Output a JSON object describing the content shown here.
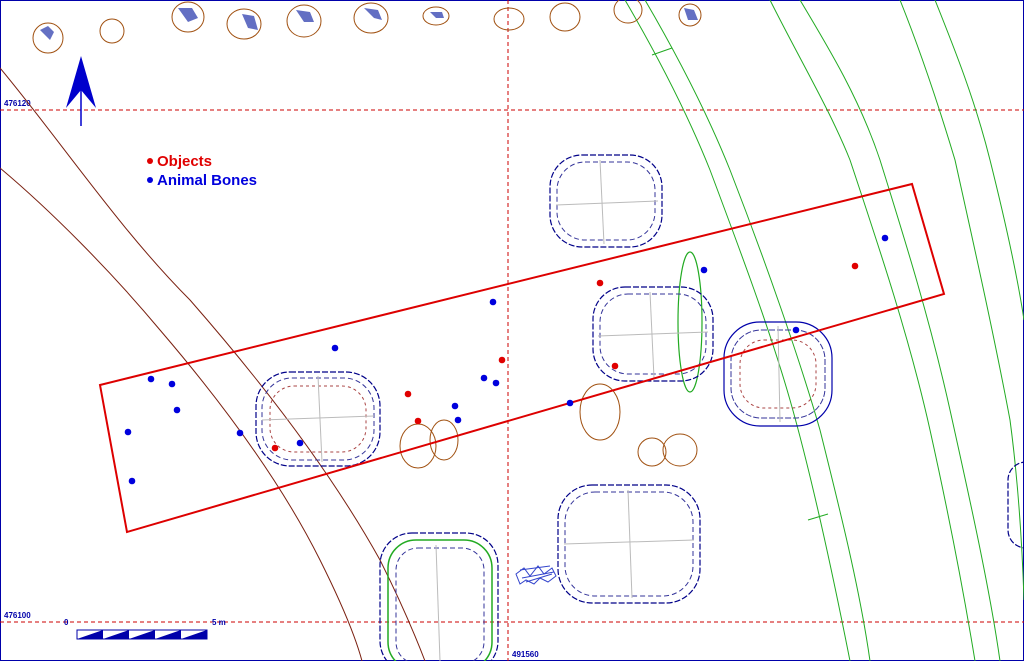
{
  "legend": {
    "items": [
      {
        "label": "Objects",
        "color": "#e00000"
      },
      {
        "label": "Animal Bones",
        "color": "#0000dd"
      }
    ]
  },
  "coordinates": {
    "north_upper": "476120",
    "north_lower": "476100",
    "east_bottom": "491560"
  },
  "scale": {
    "start_label": "0",
    "end_label": "5 m"
  },
  "colors": {
    "grid": "#cc0000",
    "trench_outline": "#dd0000",
    "feature_outline": "#000088",
    "brown_features": "#a05010",
    "contours": "#22aa22",
    "road_lines": "#7a2010",
    "north_arrow": "#0000cc",
    "background": "#ffffff"
  },
  "icons": {
    "north_arrow": "north-arrow-icon"
  },
  "finds": {
    "objects": [
      [
        855,
        266
      ],
      [
        600,
        283
      ],
      [
        502,
        360
      ],
      [
        615,
        366
      ],
      [
        408,
        394
      ],
      [
        418,
        421
      ],
      [
        275,
        448
      ]
    ],
    "animal_bones": [
      [
        885,
        238
      ],
      [
        704,
        270
      ],
      [
        493,
        302
      ],
      [
        796,
        330
      ],
      [
        335,
        348
      ],
      [
        484,
        378
      ],
      [
        496,
        383
      ],
      [
        151,
        379
      ],
      [
        172,
        384
      ],
      [
        177,
        410
      ],
      [
        455,
        406
      ],
      [
        458,
        420
      ],
      [
        570,
        403
      ],
      [
        240,
        433
      ],
      [
        128,
        432
      ],
      [
        300,
        443
      ],
      [
        132,
        481
      ]
    ]
  }
}
